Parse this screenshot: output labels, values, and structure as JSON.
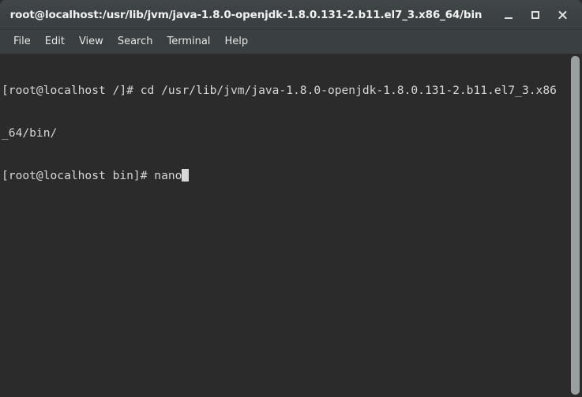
{
  "window": {
    "title": "root@localhost:/usr/lib/jvm/java-1.8.0-openjdk-1.8.0.131-2.b11.el7_3.x86_64/bin",
    "controls": [
      {
        "name": "minimize-button",
        "icon": "minimize-icon",
        "label": "_"
      },
      {
        "name": "maximize-button",
        "icon": "maximize-icon",
        "label": "□"
      },
      {
        "name": "close-button",
        "icon": "close-icon",
        "label": "✕"
      }
    ]
  },
  "menubar": {
    "items": [
      {
        "label": "File"
      },
      {
        "label": "Edit"
      },
      {
        "label": "View"
      },
      {
        "label": "Search"
      },
      {
        "label": "Terminal"
      },
      {
        "label": "Help"
      }
    ]
  },
  "terminal": {
    "lines": [
      "[root@localhost /]# cd /usr/lib/jvm/java-1.8.0-openjdk-1.8.0.131-2.b11.el7_3.x86",
      "_64/bin/",
      "[root@localhost bin]# nano"
    ],
    "prompt_line_index": 2,
    "cursor": {
      "shape": "block",
      "color": "#d8d8d8"
    }
  },
  "colors": {
    "titlebar_bg": "#3c4143",
    "menubar_bg": "#3a4042",
    "terminal_bg": "#2b2b2b",
    "terminal_fg": "#d6d6d6",
    "scrollbar_thumb": "#9aa0a0"
  },
  "scrollbar": {
    "name": "vertical-scrollbar"
  }
}
